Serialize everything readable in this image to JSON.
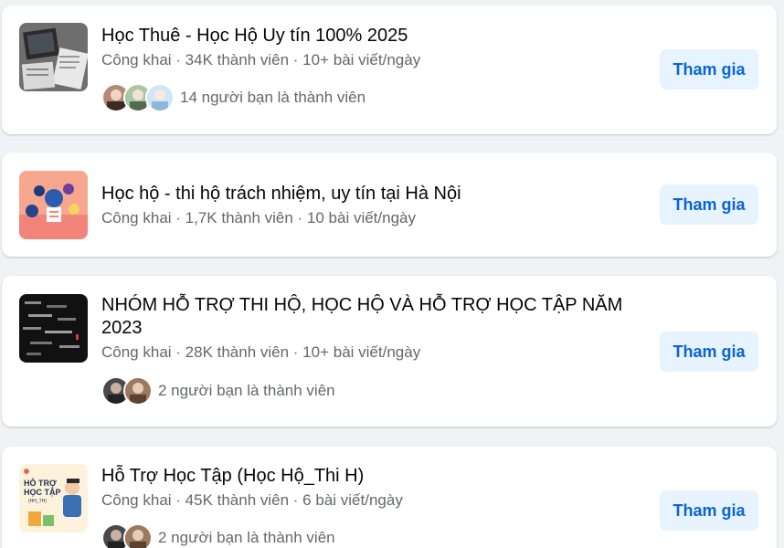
{
  "groups": [
    {
      "title": "Học Thuê - Học Hộ Uy tín 100% 2025",
      "meta": "Công khai · 34K thành viên · 10+ bài viết/ngày",
      "friends_text": "14 người bạn là thành viên",
      "join_label": "Tham gia"
    },
    {
      "title": "Học hộ - thi hộ trách nhiệm, uy tín tại Hà Nội",
      "meta": "Công khai · 1,7K thành viên · 10 bài viết/ngày",
      "join_label": "Tham gia"
    },
    {
      "title": "NHÓM HỖ TRỢ THI HỘ, HỌC HỘ VÀ HỖ TRỢ HỌC TẬP NĂM 2023",
      "meta": "Công khai · 28K thành viên · 10+ bài viết/ngày",
      "friends_text": "2 người bạn là thành viên",
      "join_label": "Tham gia"
    },
    {
      "title": "Hỗ Trợ Học Tập (Học Hộ_Thi H)",
      "meta": "Công khai · 45K thành viên · 6 bài viết/ngày",
      "friends_text": "2 người bạn là thành viên",
      "join_label": "Tham gia",
      "thumb_text": [
        "HỖ TRỢ",
        "HỌC TẬP",
        "(HH_TH)"
      ]
    }
  ]
}
